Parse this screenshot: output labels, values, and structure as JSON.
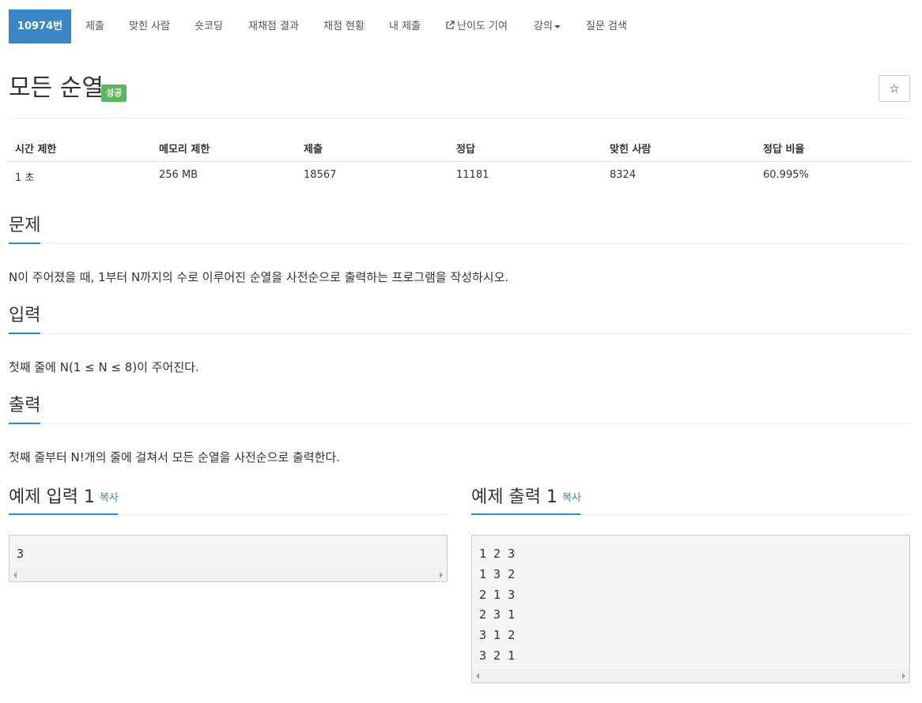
{
  "nav": {
    "problem_id": "10974번",
    "submit": "제출",
    "solved_users": "맞힌 사람",
    "shortest_code": "숏코딩",
    "rejudge_result": "재채점 결과",
    "judge_status": "채점 현황",
    "my_submissions": "내 제출",
    "difficulty_contribution": "난이도 기여",
    "lectures": "강의",
    "question_search": "질문 검색"
  },
  "problem": {
    "title": "모든 순열",
    "status_badge": "성공",
    "stats_headers": [
      "시간 제한",
      "메모리 제한",
      "제출",
      "정답",
      "맞힌 사람",
      "정답 비율"
    ],
    "stats_values": [
      "1 초",
      "256 MB",
      "18567",
      "11181",
      "8324",
      "60.995%"
    ]
  },
  "sections": {
    "description": {
      "heading": "문제",
      "text": "N이 주어졌을 때, 1부터 N까지의 수로 이루어진 순열을 사전순으로 출력하는 프로그램을 작성하시오."
    },
    "input": {
      "heading": "입력",
      "text": "첫째 줄에 N(1 ≤ N ≤ 8)이 주어진다."
    },
    "output": {
      "heading": "출력",
      "text": "첫째 줄부터 N!개의 줄에 걸쳐서 모든 순열을 사전순으로 출력한다."
    }
  },
  "samples": {
    "input_heading": "예제 입력 1",
    "output_heading": "예제 출력 1",
    "copy_label": "복사",
    "input_value": "3",
    "output_value": "1 2 3\n1 3 2\n2 1 3\n2 3 1\n3 1 2\n3 2 1"
  },
  "icons": {
    "star": "star-icon",
    "external_link": "external-link-icon",
    "caret": "caret-down-icon"
  },
  "colors": {
    "accent": "#3a87c8",
    "success_badge": "#5cb85c"
  }
}
